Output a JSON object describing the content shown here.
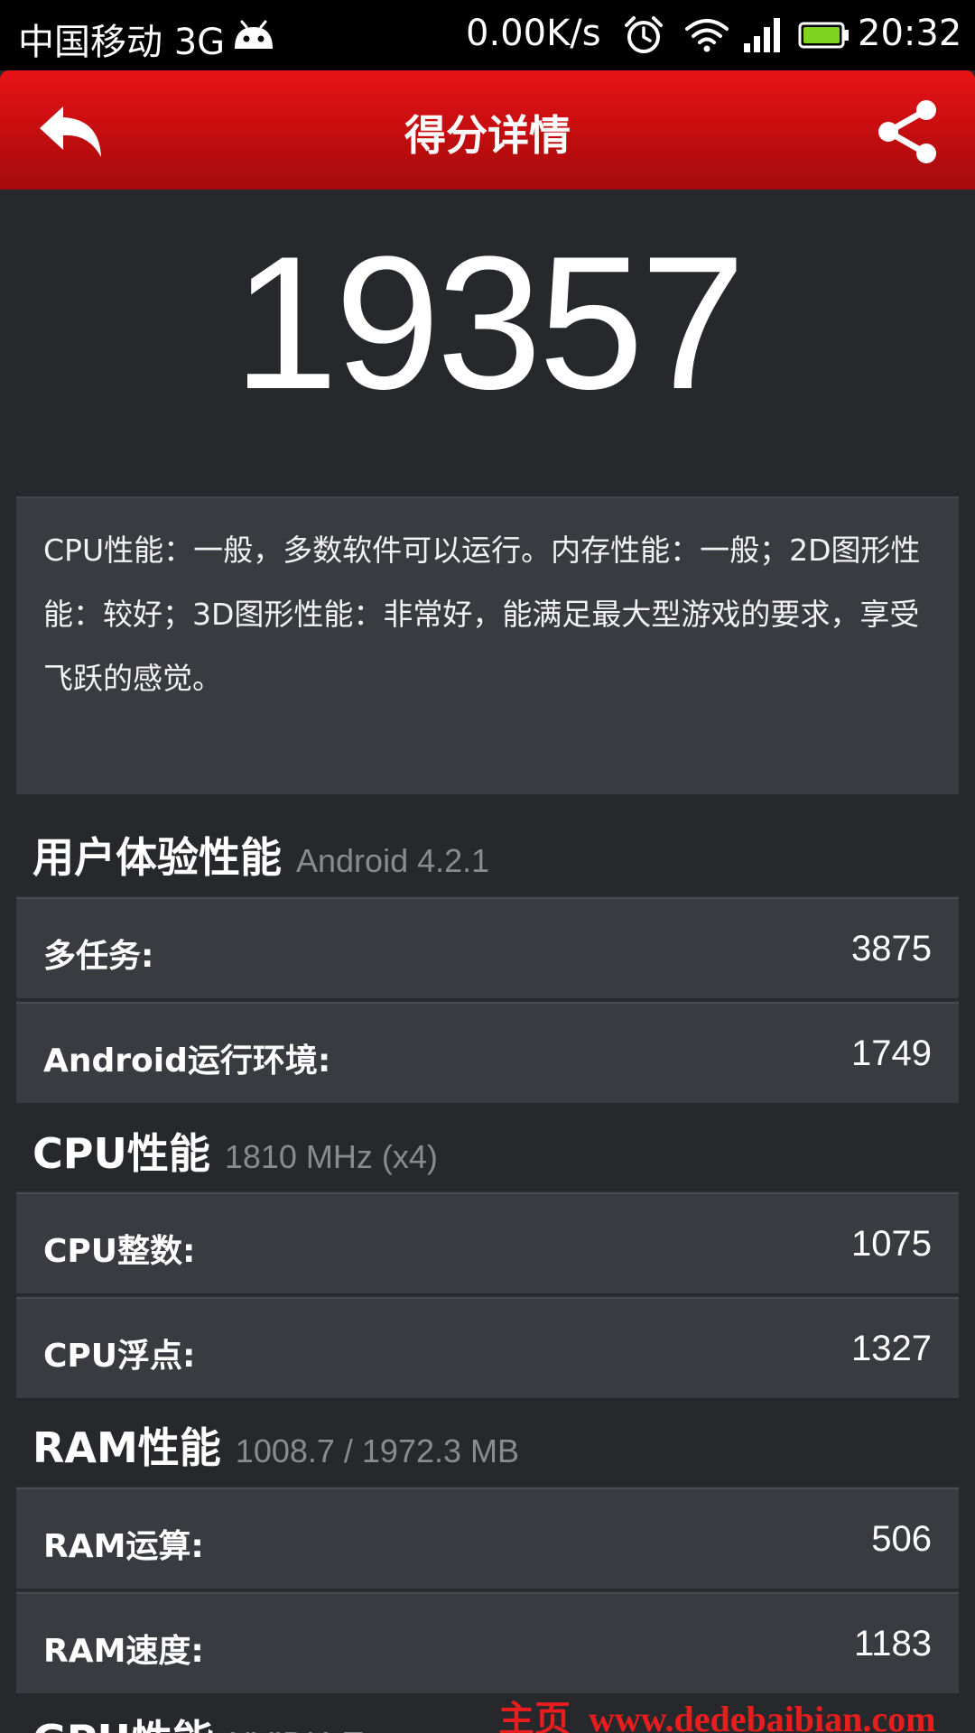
{
  "status_bar": {
    "carrier": "中国移动 3G",
    "net_speed": "0.00K/s",
    "time": "20:32",
    "icons": [
      "android-icon",
      "alarm-icon",
      "wifi-icon",
      "signal-icon",
      "battery-icon"
    ],
    "battery_color": "#7ed321"
  },
  "title_bar": {
    "title": "得分详情",
    "color": "#c20d0f",
    "icons": [
      "back-arrow-icon",
      "share-icon"
    ]
  },
  "total_score": "19357",
  "summary": "CPU性能：一般，多数软件可以运行。内存性能：一般；2D图形性能：较好；3D图形性能：非常好，能满足最大型游戏的要求，享受飞跃的感觉。",
  "sections": [
    {
      "title": "用户体验性能",
      "subtitle": "Android 4.2.1",
      "rows": [
        {
          "label": "多任务:",
          "value": "3875"
        },
        {
          "label": "Android运行环境:",
          "value": "1749"
        }
      ]
    },
    {
      "title": "CPU性能",
      "subtitle": "1810 MHz (x4)",
      "rows": [
        {
          "label": "CPU整数:",
          "value": "1075"
        },
        {
          "label": "CPU浮点:",
          "value": "1327"
        }
      ]
    },
    {
      "title": "RAM性能",
      "subtitle": "1008.7 / 1972.3 MB",
      "rows": [
        {
          "label": "RAM运算:",
          "value": "506"
        },
        {
          "label": "RAM速度:",
          "value": "1183"
        }
      ]
    },
    {
      "title": "GPU性能",
      "subtitle": "NVIDIA Tegra",
      "rows": []
    }
  ],
  "watermark": "主页_www.dedebaibian.com"
}
